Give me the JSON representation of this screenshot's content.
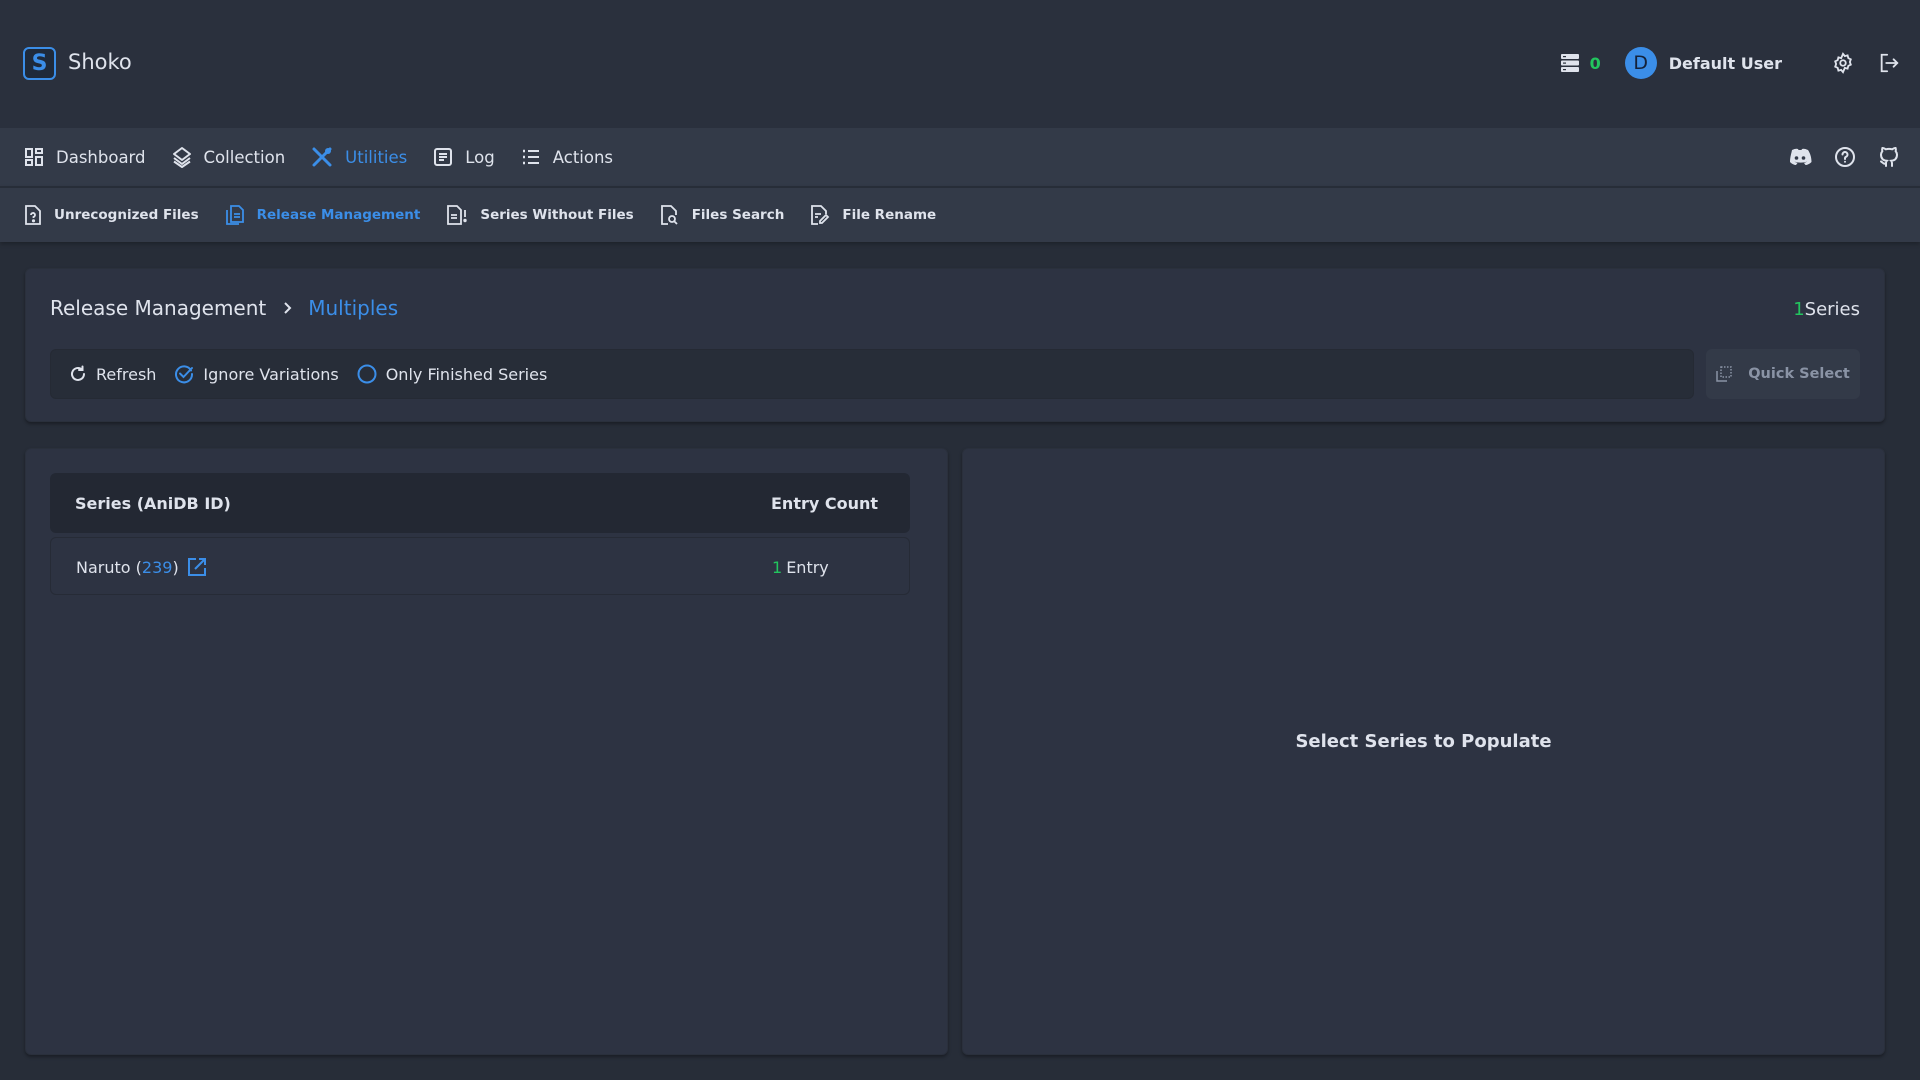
{
  "app": {
    "title": "Shoko",
    "logo_letter": "S"
  },
  "header": {
    "queue_count": "0",
    "user": {
      "avatar_letter": "D",
      "name": "Default User"
    },
    "icons": [
      "server-icon",
      "gear-icon",
      "logout-icon"
    ]
  },
  "nav": {
    "items": [
      {
        "label": "Dashboard",
        "icon": "dashboard-icon",
        "active": false
      },
      {
        "label": "Collection",
        "icon": "layers-icon",
        "active": false
      },
      {
        "label": "Utilities",
        "icon": "tools-icon",
        "active": true
      },
      {
        "label": "Log",
        "icon": "log-icon",
        "active": false
      },
      {
        "label": "Actions",
        "icon": "list-icon",
        "active": false
      }
    ],
    "right_icons": [
      "discord-icon",
      "help-icon",
      "github-icon"
    ]
  },
  "subnav": {
    "items": [
      {
        "label": "Unrecognized Files",
        "icon": "file-question-icon",
        "active": false
      },
      {
        "label": "Release Management",
        "icon": "files-icon",
        "active": true
      },
      {
        "label": "Series Without Files",
        "icon": "file-alert-icon",
        "active": false
      },
      {
        "label": "Files Search",
        "icon": "file-search-icon",
        "active": false
      },
      {
        "label": "File Rename",
        "icon": "file-edit-icon",
        "active": false
      }
    ]
  },
  "page": {
    "breadcrumb": {
      "root": "Release Management",
      "separator": ">",
      "current": "Multiples"
    },
    "series_count": {
      "number": "1",
      "label": "Series"
    },
    "toolbar": {
      "refresh": "Refresh",
      "ignore_variations": {
        "label": "Ignore Variations",
        "checked": true
      },
      "only_finished": {
        "label": "Only Finished Series",
        "checked": false
      }
    },
    "quick_select": "Quick Select"
  },
  "table": {
    "headers": {
      "series": "Series (AniDB ID)",
      "count": "Entry Count"
    },
    "rows": [
      {
        "name": "Naruto",
        "anidb_id": "239",
        "count": "1",
        "count_label": "Entry"
      }
    ]
  },
  "details": {
    "placeholder": "Select Series to Populate"
  },
  "colors": {
    "accent": "#3b8ee8",
    "success": "#22c55e",
    "background": "#272d38",
    "panel": "#2d3342"
  }
}
